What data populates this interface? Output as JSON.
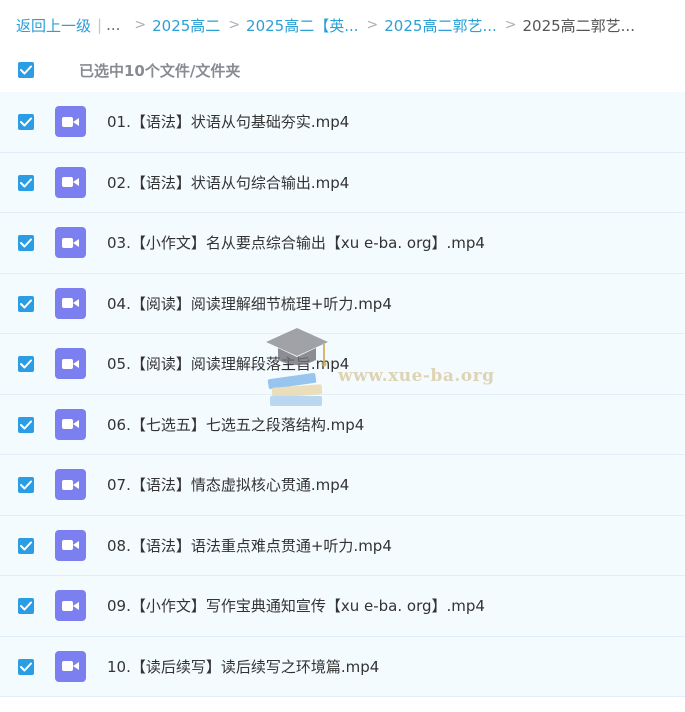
{
  "breadcrumb": {
    "back": "返回上一级",
    "separator": "|",
    "ellipsis": "...",
    "crumbs": [
      {
        "label": "2025高二"
      },
      {
        "label": "2025高二【英..."
      },
      {
        "label": "2025高二郭艺..."
      }
    ],
    "current": "2025高二郭艺..."
  },
  "selection": {
    "label": "已选中10个文件/文件夹",
    "checked": true
  },
  "files": [
    {
      "name": "01.【语法】状语从句基础夯实.mp4",
      "icon": "video-icon",
      "checked": true
    },
    {
      "name": "02.【语法】状语从句综合输出.mp4",
      "icon": "video-icon",
      "checked": true
    },
    {
      "name": "03.【小作文】名从要点综合输出【xu e-ba. org】.mp4",
      "icon": "video-icon",
      "checked": true
    },
    {
      "name": "04.【阅读】阅读理解细节梳理+听力.mp4",
      "icon": "video-icon",
      "checked": true
    },
    {
      "name": "05.【阅读】阅读理解段落主旨.mp4",
      "icon": "video-icon",
      "checked": true
    },
    {
      "name": "06.【七选五】七选五之段落结构.mp4",
      "icon": "video-icon",
      "checked": true
    },
    {
      "name": "07.【语法】情态虚拟核心贯通.mp4",
      "icon": "video-icon",
      "checked": true
    },
    {
      "name": "08.【语法】语法重点难点贯通+听力.mp4",
      "icon": "video-icon",
      "checked": true
    },
    {
      "name": "09.【小作文】写作宝典通知宣传【xu e-ba. org】.mp4",
      "icon": "video-icon",
      "checked": true
    },
    {
      "name": "10.【读后续写】读后续写之环境篇.mp4",
      "icon": "video-icon",
      "checked": true
    }
  ],
  "watermark": {
    "text": "www.xue-ba.org",
    "icon": "graduation-cap-books-icon"
  },
  "colors": {
    "link": "#2b9fd6",
    "checkbox": "#2a9de4",
    "video_icon": "#7c7ff0",
    "row_bg": "#f4fbff"
  }
}
